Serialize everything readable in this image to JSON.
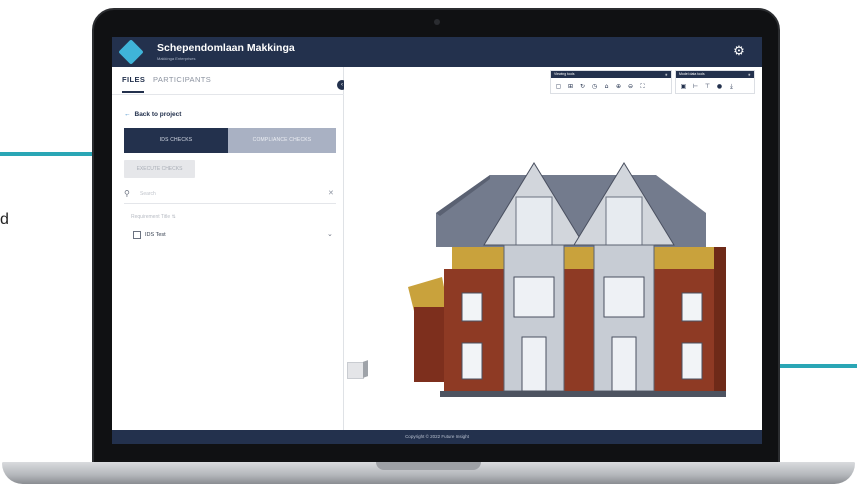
{
  "app": {
    "project_title": "Schependomlaan Makkinga",
    "project_subtitle": "Makkinga Enterprises",
    "settings_icon": "gear-icon"
  },
  "tabs": {
    "files": "FILES",
    "participants": "PARTICIPANTS"
  },
  "panel": {
    "back_label": "Back to project",
    "segment_ids": "IDS CHECKS",
    "segment_compliance": "COMPLIANCE CHECKS",
    "execute_label": "EXECUTE CHECKS",
    "search_placeholder": "Search",
    "requirement_title": "Requirement Title",
    "ids_item": "IDS Test"
  },
  "toolbars": {
    "viewing_title": "Viewing tools",
    "model_title": "Model data tools",
    "viewing_icons": [
      "frame-icon",
      "2d-3d-icon",
      "rotate-icon",
      "history-icon",
      "home-icon",
      "zoom-in-icon",
      "zoom-out-icon",
      "fit-icon"
    ],
    "model_icons": [
      "properties-icon",
      "tree-icon",
      "filter-icon",
      "info-icon",
      "download-icon"
    ]
  },
  "footer": {
    "copyright": "Copyright © 2022 Future Insight"
  },
  "cut_text": "d",
  "colors": {
    "brand_navy": "#23314d",
    "accent_teal": "#2aa6b5",
    "logo_blue": "#3fb4d9",
    "brick": "#8e3a24",
    "roof": "#6f7788"
  }
}
